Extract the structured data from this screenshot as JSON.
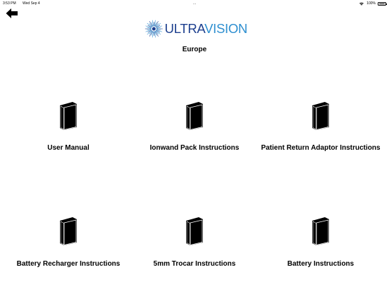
{
  "status_bar": {
    "time": "3:53 PM",
    "date": "Wed Sep 4",
    "center_dots": "...",
    "battery": "100%"
  },
  "header": {
    "logo_text_a": "ULTRA",
    "logo_text_b": "VISION",
    "region": "Europe"
  },
  "documents": [
    {
      "label": "User Manual"
    },
    {
      "label": "Ionwand Pack Instructions"
    },
    {
      "label": "Patient Return Adaptor Instructions"
    },
    {
      "label": "Battery Recharger Instructions"
    },
    {
      "label": "5mm Trocar Instructions"
    },
    {
      "label": "Battery Instructions"
    }
  ],
  "colors": {
    "logo_dark": "#1d3f8e",
    "logo_light": "#2e8fd0"
  }
}
